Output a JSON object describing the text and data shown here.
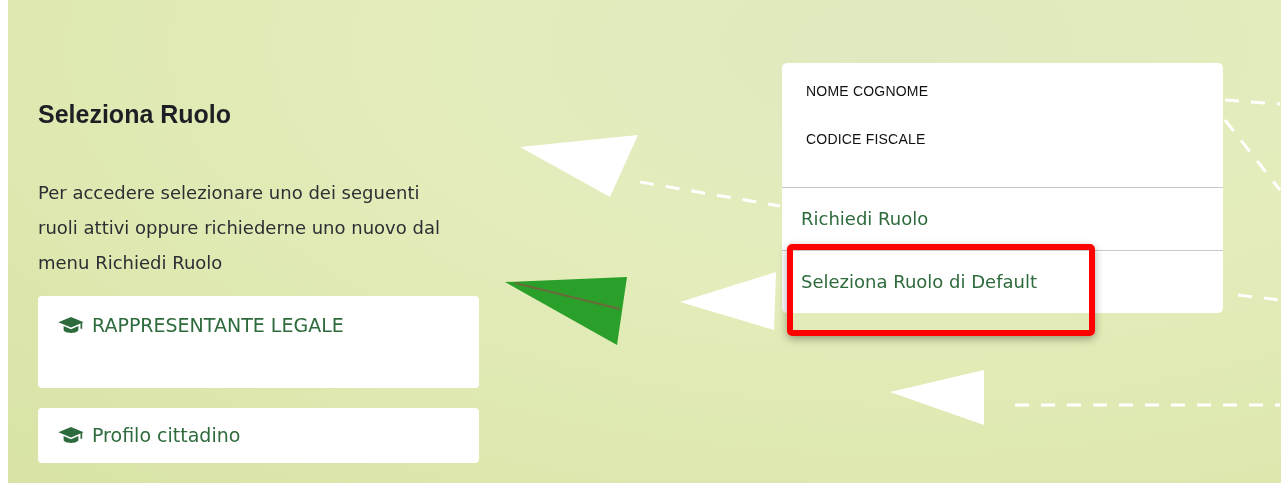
{
  "page": {
    "title": "Seleziona Ruolo",
    "description": "Per accedere selezionare uno dei seguenti ruoli attivi oppure richiederne uno nuovo dal menu Richiedi Ruolo"
  },
  "roles": [
    {
      "label": "RAPPRESENTANTE LEGALE",
      "kind": "tall"
    },
    {
      "label": "Profilo cittadino",
      "kind": "short"
    }
  ],
  "user_menu": {
    "name": "NOME COGNOME",
    "tax_code": "CODICE FISCALE",
    "items": [
      {
        "label": "Richiedi Ruolo",
        "highlighted": false
      },
      {
        "label": "Seleziona Ruolo di Default",
        "highlighted": true
      }
    ]
  }
}
